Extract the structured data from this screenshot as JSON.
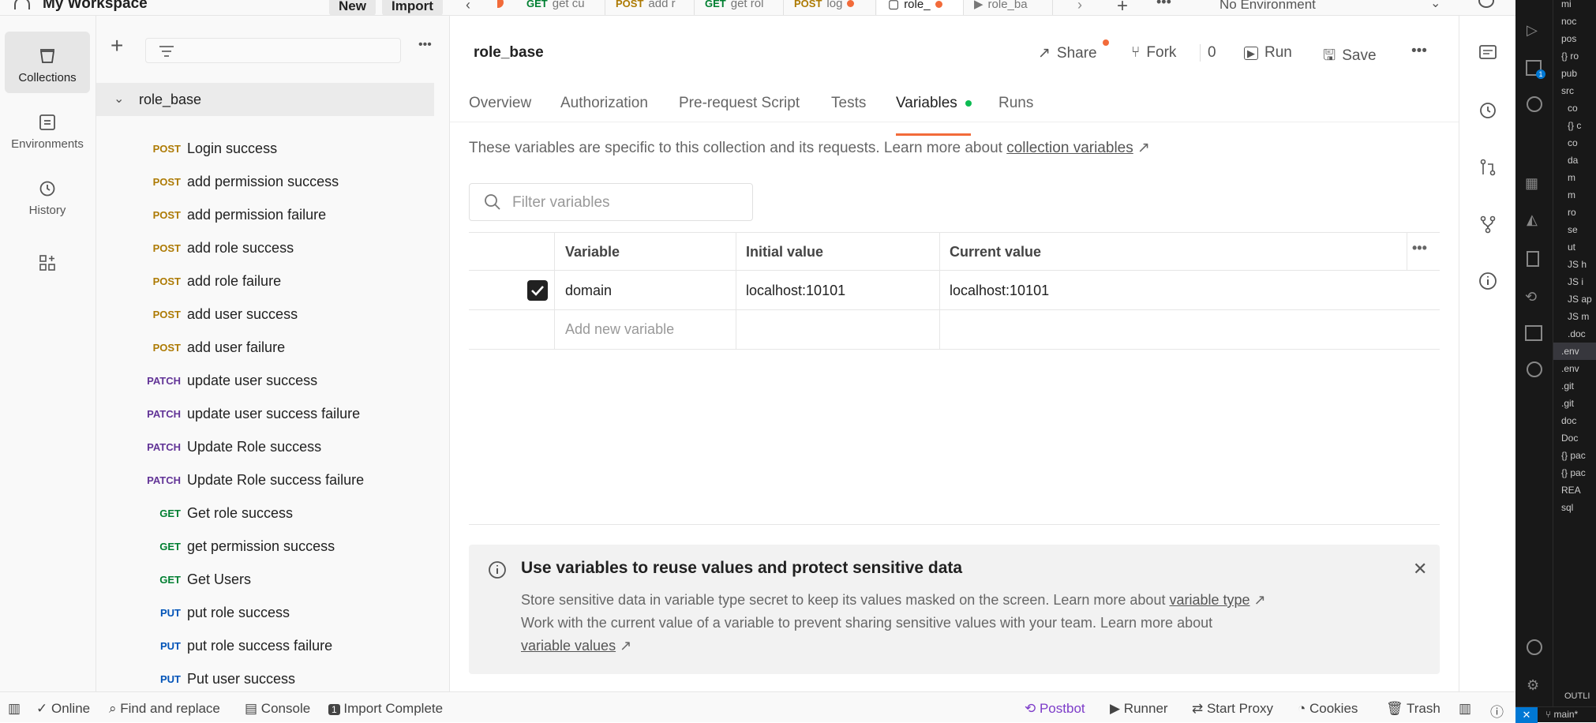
{
  "workspace": {
    "title": "My Workspace",
    "new_label": "New",
    "import_label": "Import"
  },
  "open_tabs": [
    {
      "method": "GET",
      "label": "get cu"
    },
    {
      "method": "POST",
      "label": "add r"
    },
    {
      "method": "GET",
      "label": "get rol"
    },
    {
      "method": "POST",
      "label": "log"
    },
    {
      "method": "",
      "label": "role_"
    },
    {
      "method": "",
      "label": "role_ba"
    }
  ],
  "environment": {
    "label": "No Environment"
  },
  "left_nav": [
    {
      "label": "Collections",
      "icon": "collections-icon"
    },
    {
      "label": "Environments",
      "icon": "environments-icon"
    },
    {
      "label": "History",
      "icon": "history-icon"
    }
  ],
  "collection": {
    "name": "role_base",
    "requests": [
      {
        "method": "POST",
        "name": "Login success"
      },
      {
        "method": "POST",
        "name": "add permission success"
      },
      {
        "method": "POST",
        "name": "add permission failure"
      },
      {
        "method": "POST",
        "name": "add role success"
      },
      {
        "method": "POST",
        "name": "add role failure"
      },
      {
        "method": "POST",
        "name": "add user success"
      },
      {
        "method": "POST",
        "name": "add user failure"
      },
      {
        "method": "PATCH",
        "name": "update user success"
      },
      {
        "method": "PATCH",
        "name": "update user success failure"
      },
      {
        "method": "PATCH",
        "name": "Update Role success"
      },
      {
        "method": "PATCH",
        "name": "Update Role success failure"
      },
      {
        "method": "GET",
        "name": "Get role success"
      },
      {
        "method": "GET",
        "name": "get permission success"
      },
      {
        "method": "GET",
        "name": "Get Users"
      },
      {
        "method": "PUT",
        "name": "put role success"
      },
      {
        "method": "PUT",
        "name": "put role success failure"
      },
      {
        "method": "PUT",
        "name": "Put user success"
      }
    ]
  },
  "header": {
    "title": "role_base",
    "share": "Share",
    "fork": "Fork",
    "fork_count": "0",
    "run": "Run",
    "save": "Save"
  },
  "content_tabs": [
    "Overview",
    "Authorization",
    "Pre-request Script",
    "Tests",
    "Variables",
    "Runs"
  ],
  "description": {
    "text": "These variables are specific to this collection and its requests. Learn more about ",
    "link": "collection variables"
  },
  "filter": {
    "placeholder": "Filter variables"
  },
  "table": {
    "columns": [
      "Variable",
      "Initial value",
      "Current value"
    ],
    "rows": [
      {
        "variable": "domain",
        "initial": "localhost:10101",
        "current": "localhost:10101",
        "checked": true
      }
    ],
    "add_placeholder": "Add new variable"
  },
  "notice": {
    "title": "Use variables to reuse values and protect sensitive data",
    "line1": "Store sensitive data in variable type secret to keep its values masked on the screen. Learn more about ",
    "link1": "variable type",
    "line2": "Work with the current value of a variable to prevent sharing sensitive values with your team. Learn more about ",
    "link2": "variable values"
  },
  "statusbar": {
    "online": "Online",
    "find_replace": "Find and replace",
    "console": "Console",
    "import_complete": "Import Complete",
    "postbot": "Postbot",
    "runner": "Runner",
    "start_proxy": "Start Proxy",
    "cookies": "Cookies",
    "trash": "Trash"
  },
  "vscode": {
    "tree": [
      "mi",
      "noc",
      "pos",
      "{} ro",
      "pub",
      "src",
      "co",
      "{} c",
      "co",
      "da",
      "m",
      "m",
      "ro",
      "se",
      "ut",
      "JS h",
      "JS i",
      "JS ap",
      "JS m",
      ".doc",
      ".env",
      ".env",
      ".git",
      ".git",
      "doc",
      "Doc",
      "{} pac",
      "{} pac",
      "REA",
      "sql"
    ],
    "outline": "OUTLI",
    "branch": "main*"
  },
  "colors": {
    "accent": "#f26b3a",
    "post": "#ad7a03",
    "get": "#007f31",
    "patch": "#623497",
    "put": "#0053b8"
  }
}
